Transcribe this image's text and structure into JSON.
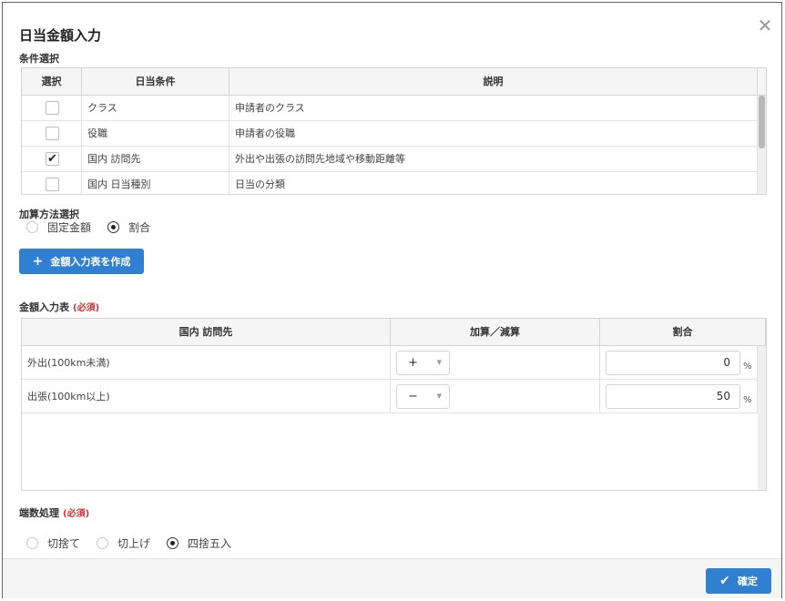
{
  "dialog": {
    "title": "日当金額入力",
    "close_label": "✕"
  },
  "conditions": {
    "section_label": "条件選択",
    "headers": [
      "選択",
      "日当条件",
      "説明"
    ],
    "rows": [
      {
        "checked": false,
        "condition": "クラス",
        "description": "申請者のクラス"
      },
      {
        "checked": false,
        "condition": "役職",
        "description": "申請者の役職"
      },
      {
        "checked": true,
        "condition": "国内 訪問先",
        "description": "外出や出張の訪問先地域や移動距離等"
      },
      {
        "checked": false,
        "condition": "国内 日当種別",
        "description": "日当の分類"
      }
    ]
  },
  "method": {
    "section_label": "加算方法選択",
    "options": [
      {
        "label": "固定金額",
        "selected": false
      },
      {
        "label": "割合",
        "selected": true
      }
    ]
  },
  "create_button": {
    "icon": "plus-icon",
    "label": "金額入力表を作成"
  },
  "amount_table": {
    "section_label": "金額入力表",
    "required": "(必須)",
    "headers": [
      "国内 訪問先",
      "加算／減算",
      "割合"
    ],
    "rows": [
      {
        "label": "外出(100km未満)",
        "sign": "+",
        "value": "0",
        "unit": "%"
      },
      {
        "label": "出張(100km以上)",
        "sign": "−",
        "value": "50",
        "unit": "%"
      }
    ]
  },
  "rounding": {
    "section_label": "端数処理",
    "required": "(必須)",
    "options": [
      {
        "label": "切捨て",
        "selected": false
      },
      {
        "label": "切上げ",
        "selected": false
      },
      {
        "label": "四捨五入",
        "selected": true
      }
    ]
  },
  "footer": {
    "confirm_icon": "check-icon",
    "confirm_label": "確定"
  },
  "colors": {
    "primary": "#2f80d1",
    "required": "#cc3333"
  }
}
